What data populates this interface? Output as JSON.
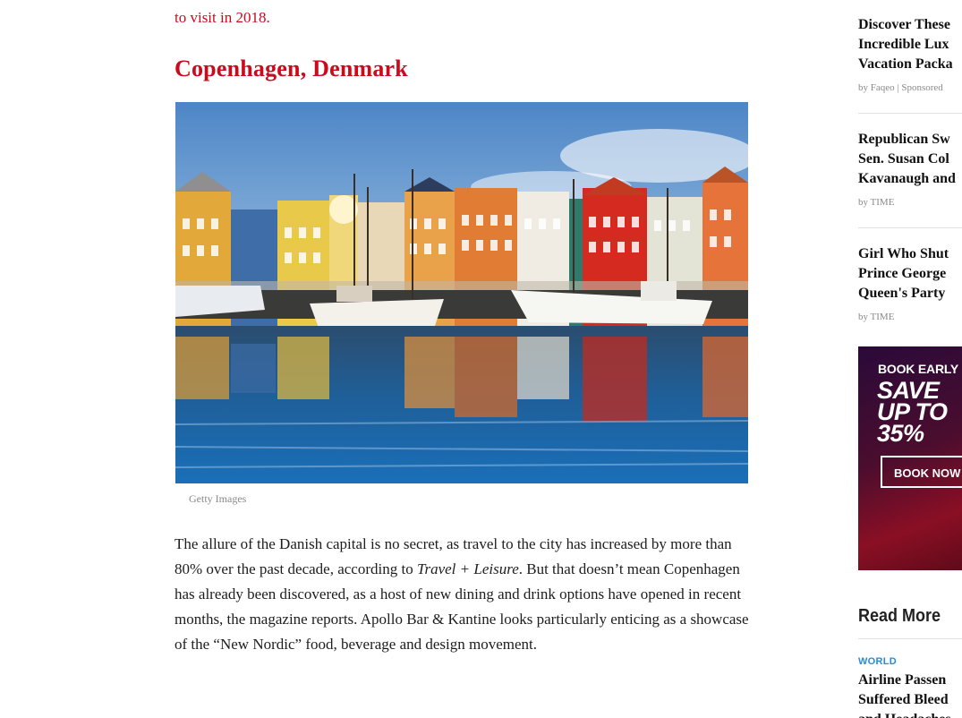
{
  "article": {
    "intro_fragment": "to visit in 2018.",
    "section_heading": "Copenhagen, Denmark",
    "image_caption": "Getty Images",
    "paragraph": {
      "part1": "The allure of the Danish capital is no secret, as travel to the city has increased by more than 80% over the past decade, according to ",
      "source": "Travel + Leisure",
      "part2": ". But that doesn’t mean Copenhagen has already been discovered, as a host of new dining and drink options have opened in recent months, the magazine reports. Apollo Bar & Kantine looks particularly enticing as a showcase of the “New Nordic” food, beverage and design movement."
    }
  },
  "sidebar": {
    "recommended": [
      {
        "line1": "Discover These",
        "line2": "Incredible Lux",
        "line3": "Vacation Packa",
        "byline": "by Faqeo | Sponsored"
      },
      {
        "line1": "Republican Sw",
        "line2": "Sen. Susan Col",
        "line3": "Kavanaugh and",
        "byline": "by TIME"
      },
      {
        "line1": "Girl Who Shut",
        "line2": "Prince George",
        "line3": "Queen's Party",
        "byline": "by TIME"
      }
    ],
    "ad": {
      "kicker": "BOOK EARLY &",
      "line1": "SAVE",
      "line2": "UP TO",
      "line3": "35%",
      "button": "BOOK NOW"
    },
    "read_more": {
      "heading": "Read More",
      "category": "WORLD",
      "line1": "Airline Passen",
      "line2": "Suffered Bleed",
      "line3": "and Headaches"
    }
  },
  "colors": {
    "accent_red": "#cc0a1e",
    "category_blue": "#2a8bd3"
  }
}
